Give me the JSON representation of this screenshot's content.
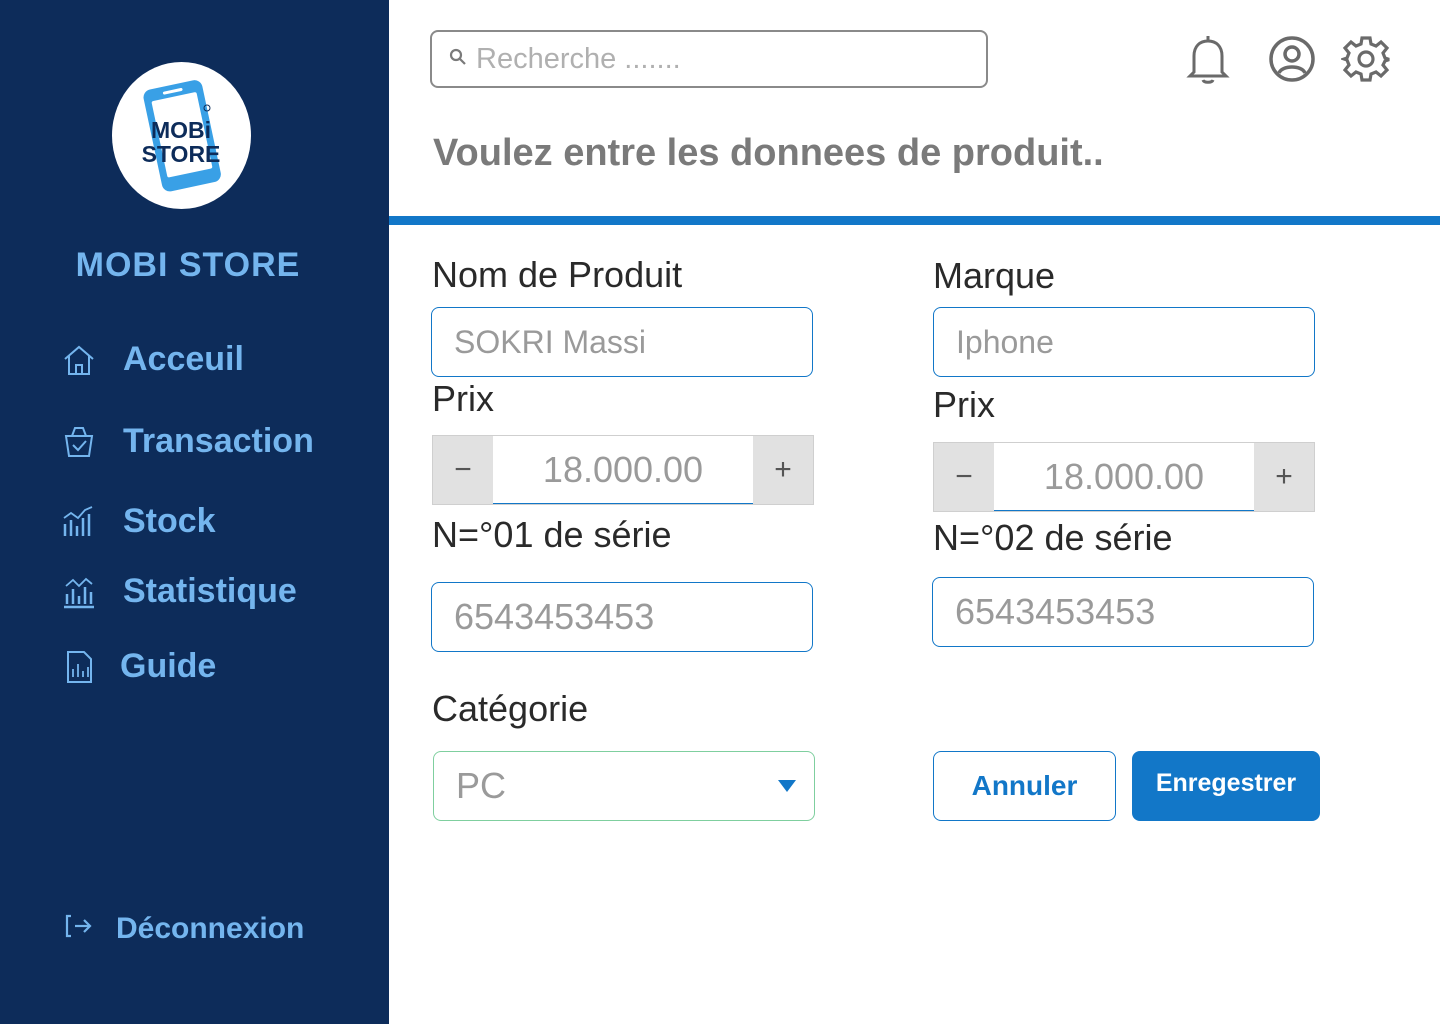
{
  "sidebar": {
    "logo_line1": "MOBi",
    "logo_line2": "STORE",
    "brand": "MOBI STORE",
    "items": [
      {
        "label": "Acceuil",
        "icon": "home-icon"
      },
      {
        "label": "Transaction",
        "icon": "basket-check-icon"
      },
      {
        "label": "Stock",
        "icon": "stock-chart-icon"
      },
      {
        "label": "Statistique",
        "icon": "statistics-chart-icon"
      },
      {
        "label": "Guide",
        "icon": "document-chart-icon"
      }
    ],
    "logout": {
      "label": "Déconnexion",
      "icon": "logout-icon"
    }
  },
  "search": {
    "placeholder": "Recherche ......."
  },
  "header_icons": [
    "bell-icon",
    "user-circle-icon",
    "gear-icon"
  ],
  "page_title": "Voulez entre les donnees de produit..",
  "form": {
    "left": {
      "name_label": "Nom de Produit",
      "name_value": "SOKRI Massi",
      "price_label": "Prix",
      "price_value": "18.000.00",
      "serial_label": "N=°01 de série",
      "serial_value": "6543453453",
      "category_label": "Catégorie",
      "category_value": "PC"
    },
    "right": {
      "brand_label": "Marque",
      "brand_value": "Iphone",
      "price_label": "Prix",
      "price_value": "18.000.00",
      "serial_label": "N=°02 de série",
      "serial_value": "6543453453"
    },
    "stepper_minus": "−",
    "stepper_plus": "+",
    "cancel_label": "Annuler",
    "save_label": "Enregestrer"
  },
  "colors": {
    "sidebar_bg": "#0d2c5a",
    "accent": "#1277c8",
    "sidebar_text": "#74b5ee"
  }
}
